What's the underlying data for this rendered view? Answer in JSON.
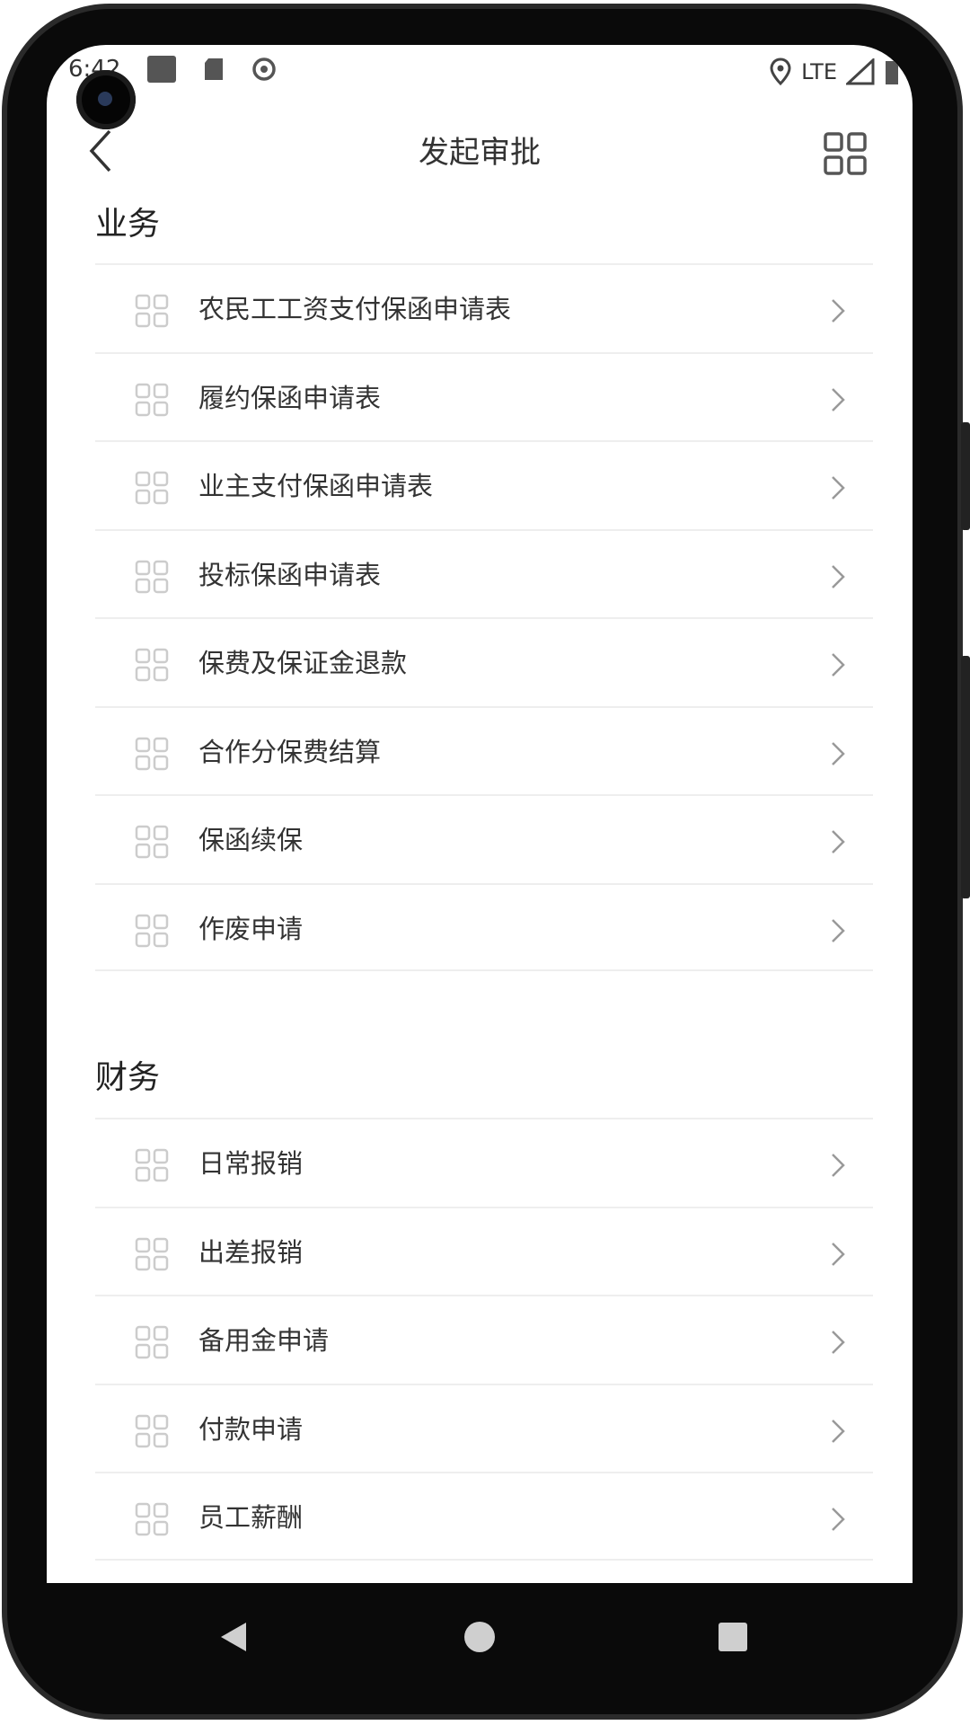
{
  "status_bar": {
    "time": "6:42",
    "network": "LTE"
  },
  "header": {
    "title": "发起审批"
  },
  "sections": [
    {
      "title": "业务",
      "items": [
        {
          "label": "农民工工资支付保函申请表"
        },
        {
          "label": "履约保函申请表"
        },
        {
          "label": "业主支付保函申请表"
        },
        {
          "label": "投标保函申请表"
        },
        {
          "label": "保费及保证金退款"
        },
        {
          "label": "合作分保费结算"
        },
        {
          "label": "保函续保"
        },
        {
          "label": "作废申请"
        }
      ]
    },
    {
      "title": "财务",
      "items": [
        {
          "label": "日常报销"
        },
        {
          "label": "出差报销"
        },
        {
          "label": "备用金申请"
        },
        {
          "label": "付款申请"
        },
        {
          "label": "员工薪酬"
        }
      ]
    }
  ],
  "colors": {
    "divider": "#eeeeee",
    "text": "#333333",
    "icon_muted": "#cccccc",
    "chevron": "#999999"
  }
}
